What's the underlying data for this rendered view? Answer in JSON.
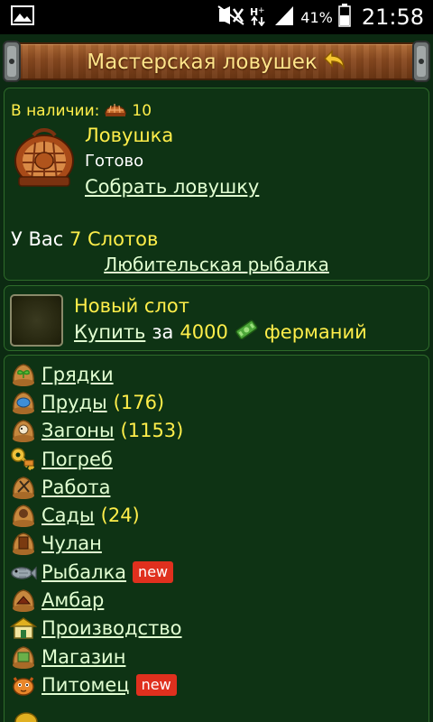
{
  "status_bar": {
    "battery_percent": "41%",
    "time": "21:58",
    "icons": [
      "image-notification-icon",
      "mute-icon",
      "data-signal-icon",
      "signal-bars-icon",
      "battery-icon"
    ]
  },
  "header": {
    "title": "Мастерская ловушек",
    "back_icon": "back-arrow-icon",
    "colors": {
      "title": "#ffe48a",
      "board": "#8a4a20"
    }
  },
  "trap_panel": {
    "stock_label": "В наличии:",
    "stock_count": "10",
    "trap_name": "Ловушка",
    "trap_status": "Готово",
    "collect_link": "Собрать ловушку",
    "slots_prefix": "У Вас",
    "slots_value": "7 Слотов",
    "fishing_link": "Любительская рыбалка"
  },
  "slot_panel": {
    "title": "Новый слот",
    "buy_link": "Купить",
    "price_prefix": "за",
    "price": "4000",
    "currency": "ферманий"
  },
  "menu": {
    "items": [
      {
        "label": "Грядки",
        "count": "",
        "icon": "sprout-icon",
        "new": ""
      },
      {
        "label": "Пруды",
        "count": "(176)",
        "icon": "pond-icon",
        "new": ""
      },
      {
        "label": "Загоны",
        "count": "(1153)",
        "icon": "pen-icon",
        "new": ""
      },
      {
        "label": "Погреб",
        "count": "",
        "icon": "key-icon",
        "new": ""
      },
      {
        "label": "Работа",
        "count": "",
        "icon": "work-icon",
        "new": ""
      },
      {
        "label": "Сады",
        "count": "(24)",
        "icon": "garden-icon",
        "new": ""
      },
      {
        "label": "Чулан",
        "count": "",
        "icon": "closet-icon",
        "new": ""
      },
      {
        "label": "Рыбалка",
        "count": "",
        "icon": "fish-icon",
        "new": "new"
      },
      {
        "label": "Амбар",
        "count": "",
        "icon": "barn-icon",
        "new": ""
      },
      {
        "label": "Производство",
        "count": "",
        "icon": "factory-icon",
        "new": ""
      },
      {
        "label": "Магазин",
        "count": "",
        "icon": "shop-icon",
        "new": ""
      },
      {
        "label": "Питомец",
        "count": "",
        "icon": "pet-icon",
        "new": "new"
      }
    ]
  },
  "colors": {
    "background": "#0c2a12",
    "panel": "#0e3314",
    "panel_border": "#2e6b2a",
    "accent_yellow": "#ffee4a",
    "link": "#e2ffd2",
    "badge": "#e0301e"
  }
}
